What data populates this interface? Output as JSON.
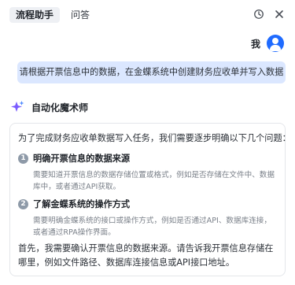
{
  "tabs": [
    {
      "label": "流程助手",
      "active": true
    },
    {
      "label": "问答",
      "active": false
    }
  ],
  "top_icons": [
    "history-icon",
    "close-icon"
  ],
  "user": {
    "name": "我",
    "message": "请根据开票信息中的数据，在金蝶系统中创建财务应收单并写入数据"
  },
  "bot": {
    "name": "自动化魔术师",
    "intro": "为了完成财务应收单数据写入任务，我们需要逐步明确以下几个问题：",
    "steps": [
      {
        "num": "1",
        "title": "明确开票信息的数据来源",
        "desc": "需要知道开票信息的数据存储位置或格式，例如是否存储在文件中、数据库中，或者通过API获取。"
      },
      {
        "num": "2",
        "title": "了解金蝶系统的操作方式",
        "desc": "需要明确金蝶系统的接口或操作方式，例如是否通过API、数据库连接，或者通过RPA操作界面。"
      }
    ],
    "conclusion": "首先，我需要确认开票信息的数据来源。请告诉我开票信息存储在哪里，例如文件路径、数据库连接信息或API接口地址。"
  },
  "colors": {
    "accent": "#1f6bff",
    "bubble": "#dbe7ff",
    "sparkle_purple": "#7a5cff",
    "sparkle_blue": "#4f8bff"
  }
}
